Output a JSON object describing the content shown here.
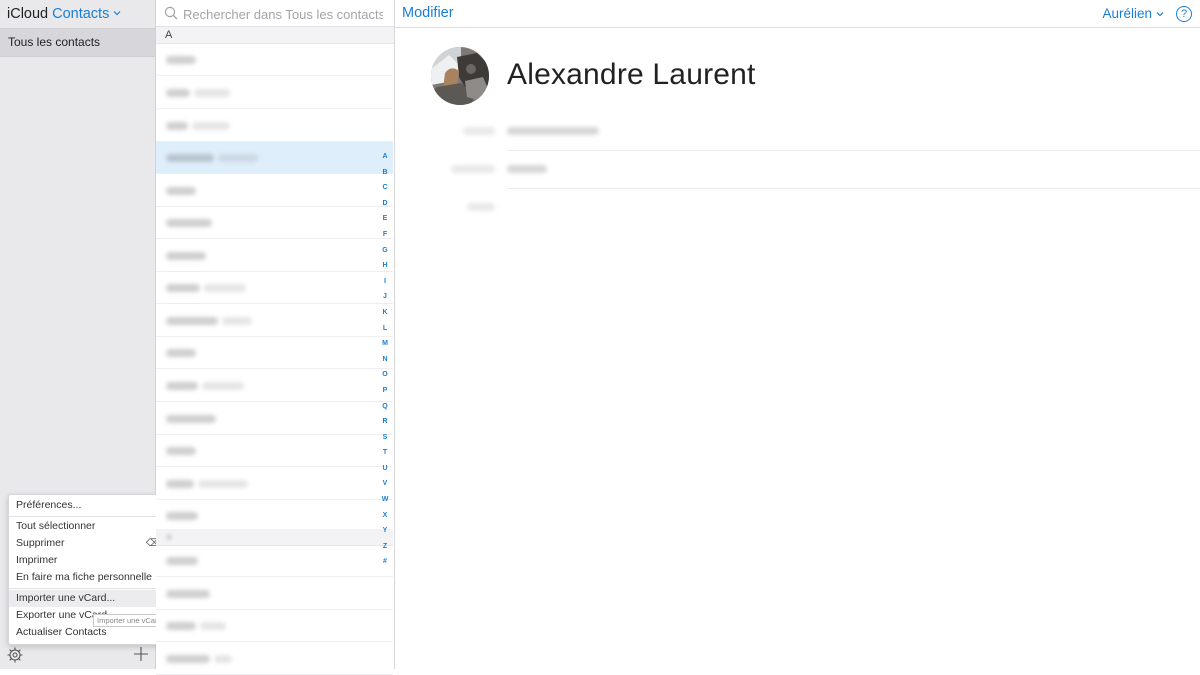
{
  "app": {
    "brand": "iCloud",
    "name": "Contacts"
  },
  "sidebar": {
    "group_label": "Tous les contacts"
  },
  "menu": {
    "items": [
      "Préférences...",
      "Tout sélectionner",
      "Supprimer",
      "Imprimer",
      "En faire ma fiche personnelle",
      "Importer une vCard...",
      "Exporter une vCard...",
      "Actualiser Contacts"
    ],
    "delete_key_glyph": "⌫",
    "tooltip": "Importer une vCard"
  },
  "search": {
    "placeholder": "Rechercher dans Tous les contacts"
  },
  "list": {
    "section_header": "A",
    "selected_row_index": 3,
    "index_letters": [
      "A",
      "B",
      "C",
      "D",
      "E",
      "F",
      "G",
      "H",
      "I",
      "J",
      "K",
      "L",
      "M",
      "N",
      "O",
      "P",
      "Q",
      "R",
      "S",
      "T",
      "U",
      "V",
      "W",
      "X",
      "Y",
      "Z",
      "#"
    ]
  },
  "detail": {
    "edit_label": "Modifier",
    "user_name": "Aurélien",
    "help_glyph": "?",
    "contact_name": "Alexandre Laurent"
  },
  "colors": {
    "accent": "#1a7fd4",
    "selected_row": "#dfeefb",
    "sidebar_bg": "#e9e9eb"
  },
  "icons": {
    "settings": "gear-icon",
    "add": "plus-icon",
    "search": "search-icon",
    "help": "help-icon"
  }
}
